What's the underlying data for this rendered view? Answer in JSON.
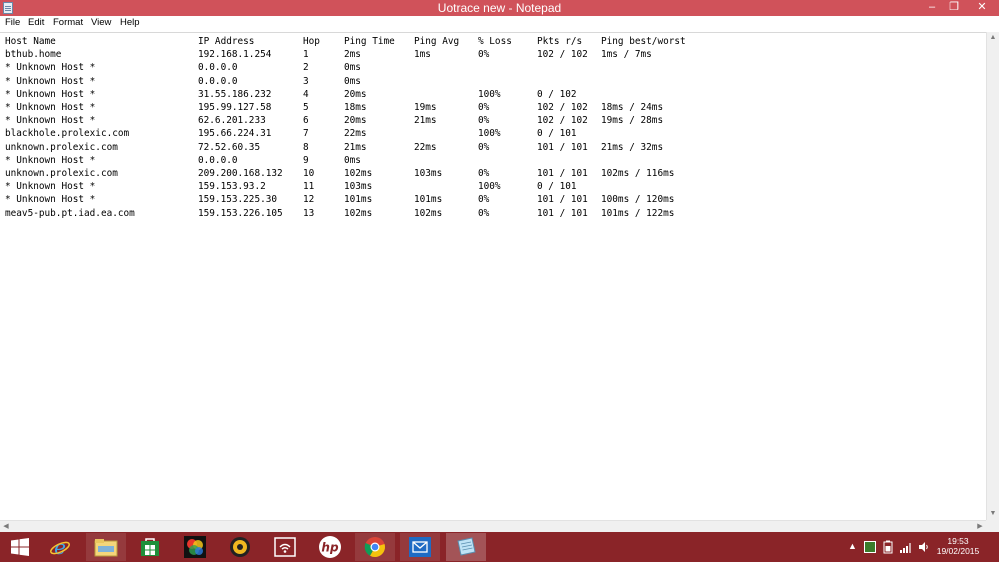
{
  "window": {
    "title": "Uotrace new - Notepad",
    "minimize_glyph": "–",
    "maximize_glyph": "❐",
    "close_glyph": "✕"
  },
  "menu": [
    "File",
    "Edit",
    "Format",
    "View",
    "Help"
  ],
  "table": {
    "headers": [
      "Host Name",
      "IP Address",
      "Hop",
      "Ping Time",
      "Ping Avg",
      "% Loss",
      "Pkts r/s",
      "Ping best/worst"
    ],
    "rows": [
      [
        "bthub.home",
        "192.168.1.254",
        "1",
        "2ms",
        "1ms",
        "0%",
        "102 / 102",
        "1ms / 7ms"
      ],
      [
        "* Unknown Host *",
        "0.0.0.0",
        "2",
        "0ms",
        "",
        "",
        "",
        ""
      ],
      [
        "* Unknown Host *",
        "0.0.0.0",
        "3",
        "0ms",
        "",
        "",
        "",
        ""
      ],
      [
        "* Unknown Host *",
        "31.55.186.232",
        "4",
        "20ms",
        "",
        "100%",
        "0 / 102",
        ""
      ],
      [
        "* Unknown Host *",
        "195.99.127.58",
        "5",
        "18ms",
        "19ms",
        "0%",
        "102 / 102",
        "18ms / 24ms"
      ],
      [
        "* Unknown Host *",
        "62.6.201.233",
        "6",
        "20ms",
        "21ms",
        "0%",
        "102 / 102",
        "19ms / 28ms"
      ],
      [
        "blackhole.prolexic.com",
        "195.66.224.31",
        "7",
        "22ms",
        "",
        "100%",
        "0 / 101",
        ""
      ],
      [
        "unknown.prolexic.com",
        "72.52.60.35",
        "8",
        "21ms",
        "22ms",
        "0%",
        "101 / 101",
        "21ms / 32ms"
      ],
      [
        "* Unknown Host *",
        "0.0.0.0",
        "9",
        "0ms",
        "",
        "",
        "",
        ""
      ],
      [
        "unknown.prolexic.com",
        "209.200.168.132",
        "10",
        "102ms",
        "103ms",
        "0%",
        "101 / 101",
        "102ms / 116ms"
      ],
      [
        "* Unknown Host *",
        "159.153.93.2",
        "11",
        "103ms",
        "",
        "100%",
        "0 / 101",
        ""
      ],
      [
        "* Unknown Host *",
        "159.153.225.30",
        "12",
        "101ms",
        "101ms",
        "0%",
        "101 / 101",
        "100ms / 120ms"
      ],
      [
        "meav5-pub.pt.iad.ea.com",
        "159.153.226.105",
        "13",
        "102ms",
        "102ms",
        "0%",
        "101 / 101",
        "101ms / 122ms"
      ]
    ]
  },
  "taskbar": {
    "apps": [
      {
        "name": "start-button",
        "icon": "windows-logo"
      },
      {
        "name": "internet-explorer",
        "icon": "ie-icon"
      },
      {
        "name": "file-explorer",
        "icon": "folder-icon"
      },
      {
        "name": "store",
        "icon": "store-icon"
      },
      {
        "name": "photo-app",
        "icon": "colorful-app-icon"
      },
      {
        "name": "media-app",
        "icon": "media-icon"
      },
      {
        "name": "wifi-app",
        "icon": "wifi-app-icon"
      },
      {
        "name": "hp-app",
        "icon": "hp-icon"
      },
      {
        "name": "chrome",
        "icon": "chrome-icon"
      },
      {
        "name": "mail",
        "icon": "mail-icon"
      },
      {
        "name": "notepad",
        "icon": "notepad-icon"
      }
    ],
    "clock_time": "19:53",
    "clock_date": "19/02/2015"
  },
  "colors": {
    "titlebar": "#d0525a",
    "taskbar": "#8a2428"
  }
}
